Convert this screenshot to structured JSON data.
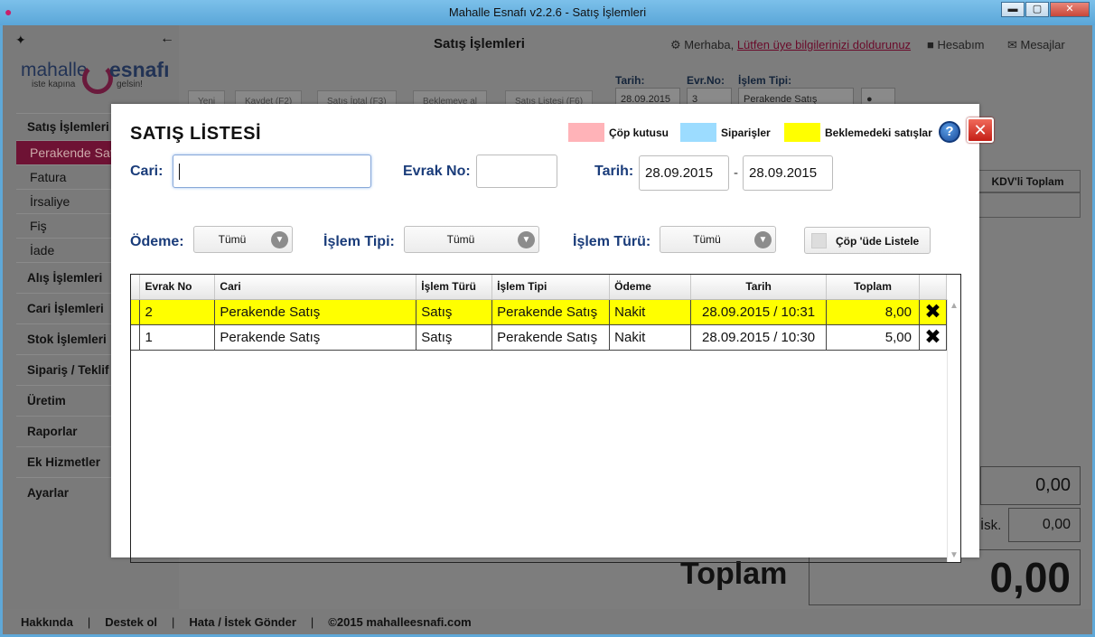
{
  "window": {
    "title": "Mahalle Esnafı v2.2.6 - Satış İşlemleri",
    "minimize": "▬",
    "maximize": "▢",
    "close": "✕"
  },
  "sidebar": {
    "logo": {
      "word1": "mahalle",
      "word2": "esnafı",
      "tagline1": "iste kapına",
      "tagline2": "gelsin!"
    },
    "menu": [
      {
        "label": "Satış İşlemleri"
      },
      {
        "label": "Alış İşlemleri"
      },
      {
        "label": "Cari İşlemleri"
      },
      {
        "label": "Stok İşlemleri"
      },
      {
        "label": "Sipariş / Teklif"
      },
      {
        "label": "Üretim"
      },
      {
        "label": "Raporlar"
      },
      {
        "label": "Ek Hizmetler"
      },
      {
        "label": "Ayarlar"
      }
    ],
    "submenu": [
      {
        "label": "Perakende Satış"
      },
      {
        "label": "Fatura"
      },
      {
        "label": "İrsaliye"
      },
      {
        "label": "Fiş"
      },
      {
        "label": "İade"
      }
    ]
  },
  "header": {
    "title": "Satış İşlemleri",
    "greeting": "Merhaba,",
    "fill_info": "Lütfen üye bilgilerinizi doldurunuz",
    "account": "Hesabım",
    "messages": "Mesajlar"
  },
  "toolbar": {
    "tarih_label": "Tarih:",
    "evrno_label": "Evr.No:",
    "islem_tipi_label": "İşlem Tipi:",
    "buttons": [
      "Yeni",
      "Kaydet (F2)",
      "Satış İptal (F3)",
      "Beklemeye al",
      "Satış Listesi (F6)"
    ],
    "tarih_value": "28.09.2015",
    "evrno_value": "3",
    "islem_tipi_value": "Perakende Satış"
  },
  "background": {
    "kdv_total_header": "KDV'li Toplam",
    "subtotal": "0,00",
    "isk_label": "İsk.",
    "isk_value": "0,00",
    "toplam_label": "Toplam",
    "toplam_value": "0,00"
  },
  "footer": {
    "about": "Hakkında",
    "support": "Destek ol",
    "feedback": "Hata / İstek Gönder",
    "copyright": "©2015 mahalleesnafi.com"
  },
  "modal": {
    "title": "SATIŞ LİSTESİ",
    "legend": [
      {
        "label": "Çöp kutusu",
        "color": "#ffb3b8"
      },
      {
        "label": "Siparişler",
        "color": "#9cdcff"
      },
      {
        "label": "Beklemedeki satışlar",
        "color": "#ffff00"
      }
    ],
    "help": "?",
    "filters": {
      "cari_label": "Cari:",
      "cari_value": "",
      "evrak_no_label": "Evrak No:",
      "evrak_no_value": "",
      "tarih_label": "Tarih:",
      "tarih_from": "28.09.2015",
      "tarih_sep": "-",
      "tarih_to": "28.09.2015",
      "odeme_label": "Ödeme:",
      "odeme_value": "Tümü",
      "islem_tipi_label": "İşlem Tipi:",
      "islem_tipi_value": "Tümü",
      "islem_turu_label": "İşlem Türü:",
      "islem_turu_value": "Tümü",
      "cop_listele": "Çöp 'üde Listele"
    },
    "table": {
      "columns": [
        "Evrak No",
        "Cari",
        "İşlem Türü",
        "İşlem Tipi",
        "Ödeme",
        "Tarih",
        "Toplam"
      ],
      "rows": [
        {
          "evrak_no": "2",
          "cari": "Perakende Satış",
          "islem_turu": "Satış",
          "islem_tipi": "Perakende Satış",
          "odeme": "Nakit",
          "tarih": "28.09.2015 / 10:31",
          "toplam": "8,00",
          "status": "pending"
        },
        {
          "evrak_no": "1",
          "cari": "Perakende Satış",
          "islem_turu": "Satış",
          "islem_tipi": "Perakende Satış",
          "odeme": "Nakit",
          "tarih": "28.09.2015 / 10:30",
          "toplam": "5,00",
          "status": "normal"
        }
      ]
    },
    "close": "✕"
  }
}
